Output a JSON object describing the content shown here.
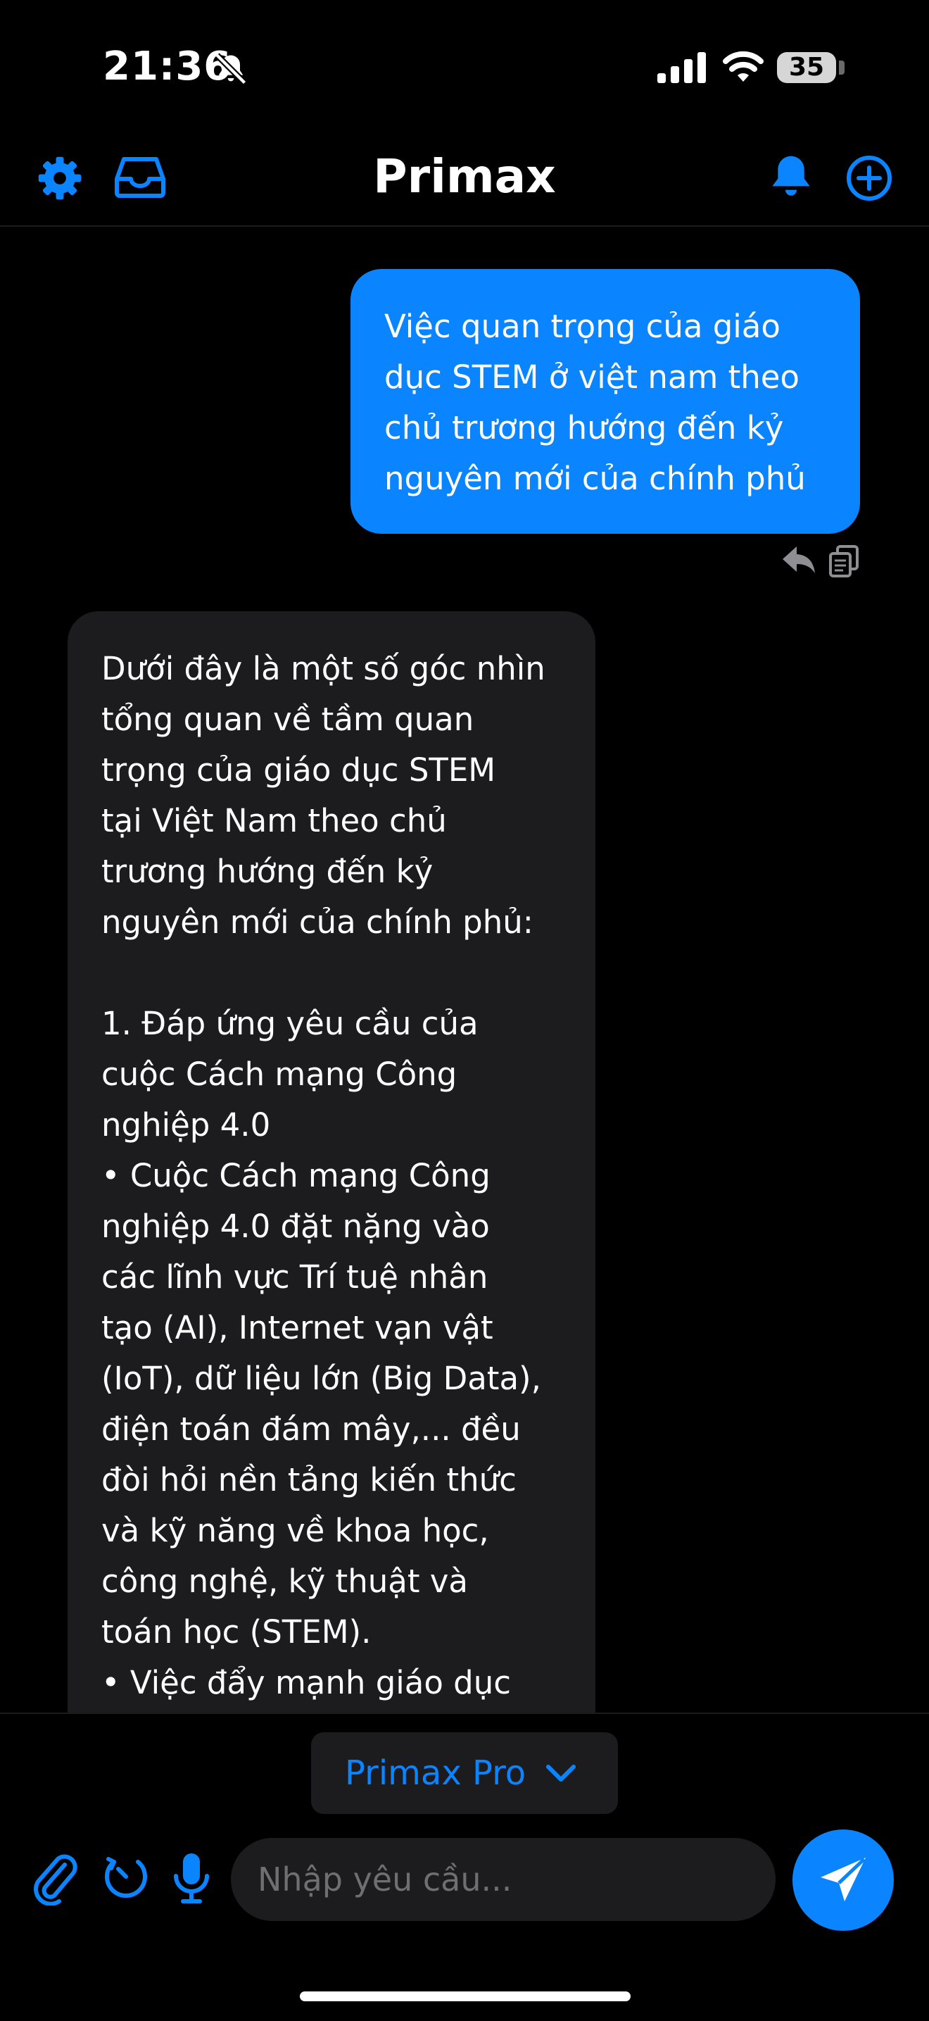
{
  "status_bar": {
    "time": "21:36",
    "battery_level": "35",
    "icons": [
      "bell-slash-icon",
      "cellular-signal-icon",
      "wifi-icon",
      "battery-icon"
    ]
  },
  "nav": {
    "title": "Primax",
    "icons": [
      "gear-icon",
      "inbox-tray-icon",
      "bell-icon",
      "plus-circle-icon"
    ]
  },
  "conversation": {
    "user_message": "Việc quan trọng của giáo\ndục STEM ở việt nam theo\nchủ trương hướng đến kỷ\nnguyên mới của chính phủ",
    "message_actions": [
      "reply-icon",
      "copy-icon"
    ],
    "assistant_message": "Dưới đây là một số góc nhìn\ntổng quan về tầm quan\ntrọng của giáo dục STEM\ntại Việt Nam theo chủ\ntrương hướng đến kỷ\nnguyên mới của chính phủ:\n\n1. Đáp ứng yêu cầu của\ncuộc Cách mạng Công\nnghiệp 4.0\n   • Cuộc Cách mạng Công\nnghiệp 4.0 đặt nặng vào\ncác lĩnh vực Trí tuệ nhân\ntạo (AI), Internet vạn vật\n(IoT), dữ liệu lớn (Big Data),\nđiện toán đám mây,... đều\nđòi hỏi nền tảng kiến thức\nvà kỹ năng về khoa học,\ncông nghệ, kỹ thuật và\ntoán học (STEM).\n   • Việc đẩy mạnh giáo dục"
  },
  "composer": {
    "model_label": "Primax Pro",
    "input_value": "",
    "input_placeholder": "Nhập yêu cầu...",
    "icons": [
      "paperclip-icon",
      "history-icon",
      "microphone-icon",
      "send-icon",
      "chevron-down-icon"
    ]
  },
  "colors": {
    "accent": "#0a84ff",
    "background": "#000000",
    "bubble_dark": "#1c1c1e",
    "placeholder": "#6e6e73"
  }
}
